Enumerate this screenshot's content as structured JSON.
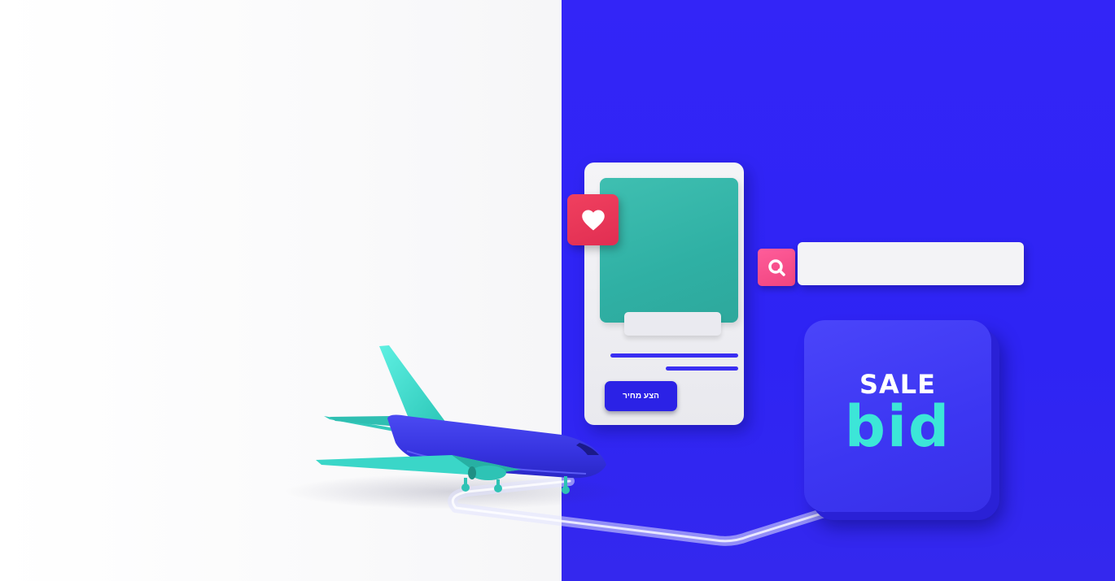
{
  "hero": {
    "bid_button_label": "הצע מחיר",
    "search": {
      "value": "",
      "placeholder": ""
    },
    "sale_tile": {
      "sale_label": "SALE",
      "logo_text": "bid"
    }
  },
  "colors": {
    "left_background": "#ffffff",
    "right_background": "#3325f7",
    "teal_accent": "#2fb0a4",
    "heart_red": "#e12e52",
    "search_pink": "#f0447f",
    "logo_cyan": "#3ce6d8",
    "airplane_body": "#3b39e8",
    "airplane_tail": "#3ad6c8"
  },
  "icons": {
    "heart": "heart-icon",
    "search": "search-icon",
    "airplane": "airplane-illustration"
  }
}
